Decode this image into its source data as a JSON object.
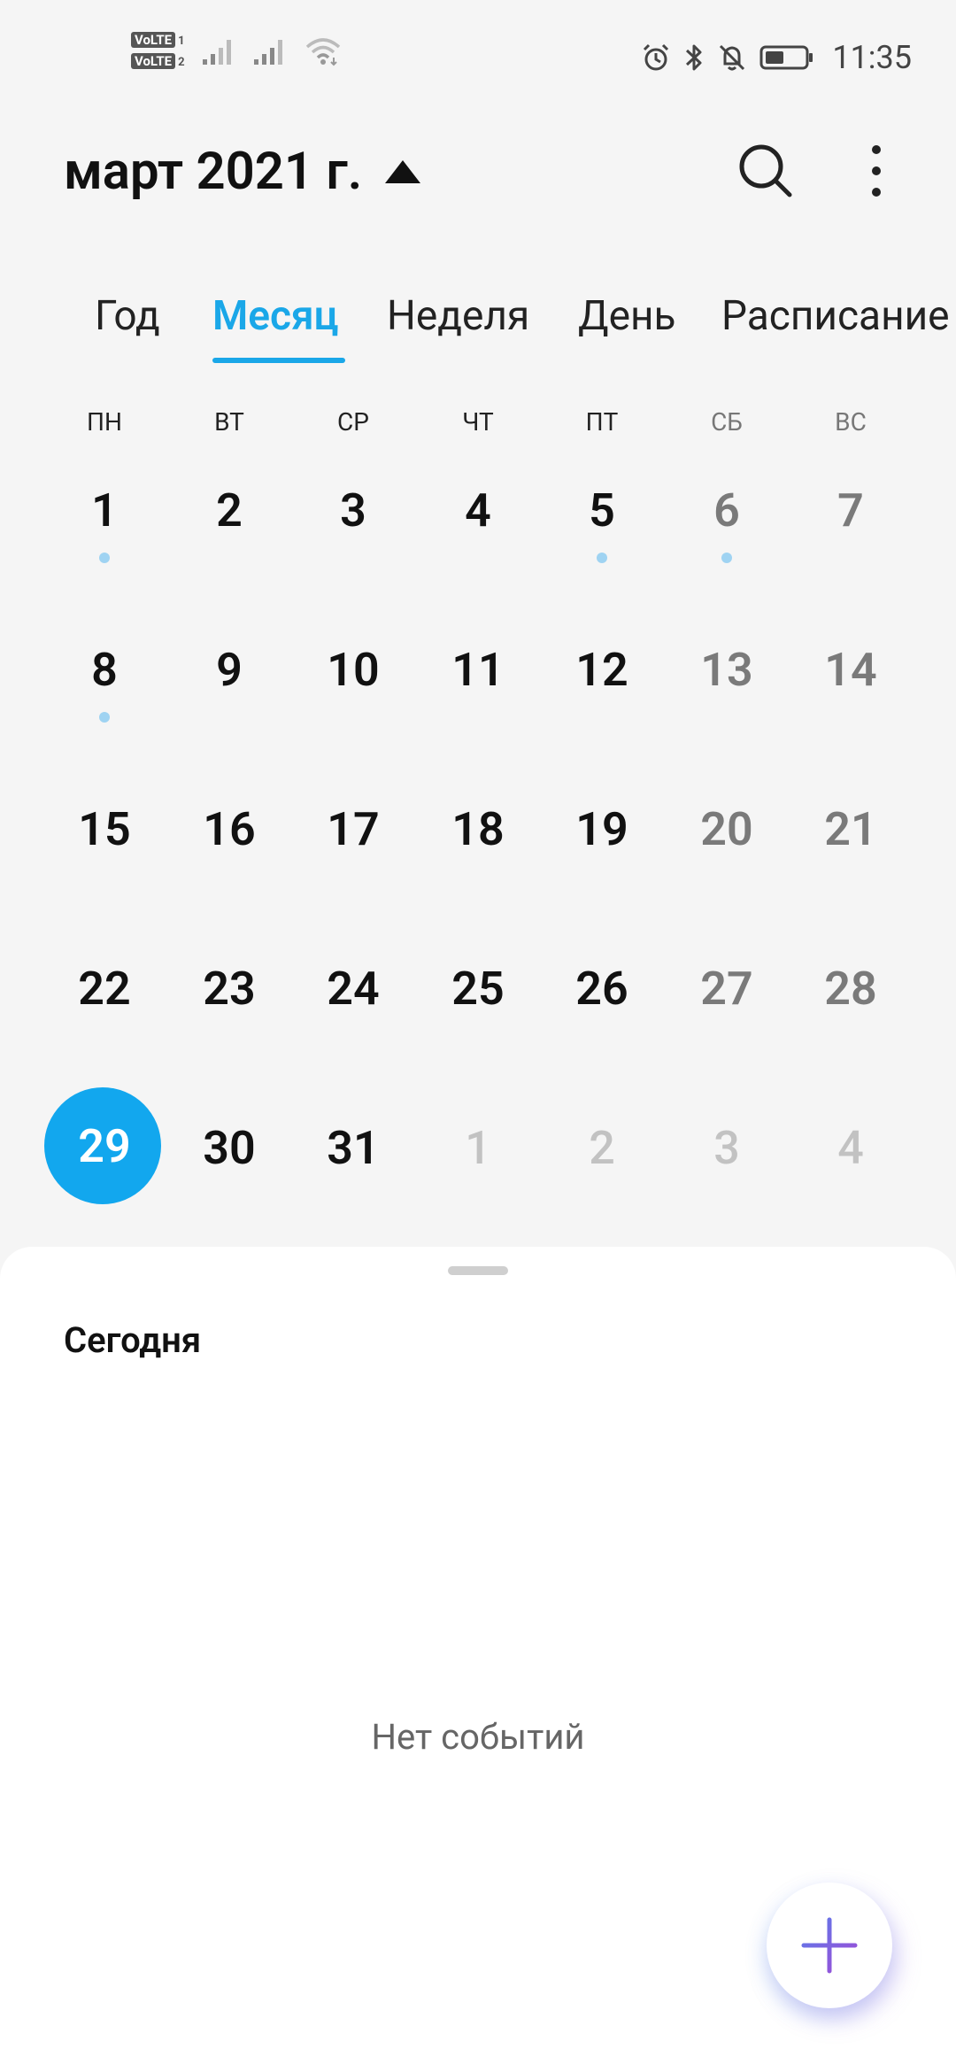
{
  "status_bar": {
    "sim1_badge": "VoLTE",
    "sim1_num": "1",
    "sim2_badge": "VoLTE",
    "sim2_num": "2",
    "time": "11:35"
  },
  "header": {
    "title": "март 2021 г."
  },
  "tabs": [
    {
      "label": "Год"
    },
    {
      "label": "Месяц"
    },
    {
      "label": "Неделя"
    },
    {
      "label": "День"
    },
    {
      "label": "Расписание"
    }
  ],
  "active_tab": "Месяц",
  "weekdays": [
    "ПН",
    "ВТ",
    "СР",
    "ЧТ",
    "ПТ",
    "СБ",
    "ВС"
  ],
  "weeks": [
    [
      {
        "day": "1",
        "event": true
      },
      {
        "day": "2"
      },
      {
        "day": "3"
      },
      {
        "day": "4"
      },
      {
        "day": "5",
        "event": true
      },
      {
        "day": "6",
        "event": true
      },
      {
        "day": "7"
      }
    ],
    [
      {
        "day": "8",
        "event": true
      },
      {
        "day": "9"
      },
      {
        "day": "10"
      },
      {
        "day": "11"
      },
      {
        "day": "12"
      },
      {
        "day": "13"
      },
      {
        "day": "14"
      }
    ],
    [
      {
        "day": "15"
      },
      {
        "day": "16"
      },
      {
        "day": "17"
      },
      {
        "day": "18"
      },
      {
        "day": "19"
      },
      {
        "day": "20"
      },
      {
        "day": "21"
      }
    ],
    [
      {
        "day": "22"
      },
      {
        "day": "23"
      },
      {
        "day": "24"
      },
      {
        "day": "25"
      },
      {
        "day": "26"
      },
      {
        "day": "27"
      },
      {
        "day": "28"
      }
    ],
    [
      {
        "day": "29",
        "today": true
      },
      {
        "day": "30"
      },
      {
        "day": "31"
      },
      {
        "day": "1",
        "other_month": true
      },
      {
        "day": "2",
        "other_month": true
      },
      {
        "day": "3",
        "other_month": true
      },
      {
        "day": "4",
        "other_month": true
      }
    ]
  ],
  "sheet": {
    "today_label": "Сегодня",
    "empty_text": "Нет событий"
  },
  "colors": {
    "accent": "#1aa7e8",
    "today_circle": "#12a7ee",
    "event_dot": "#9fd3f2",
    "fab_plus_start": "#5b7bea",
    "fab_plus_end": "#a04bd6"
  },
  "icons": [
    "signal-icon",
    "wifi-icon",
    "alarm-icon",
    "bluetooth-icon",
    "muted-bell-icon",
    "battery-icon",
    "dropdown-triangle-icon",
    "search-icon",
    "more-vert-icon",
    "plus-icon"
  ]
}
